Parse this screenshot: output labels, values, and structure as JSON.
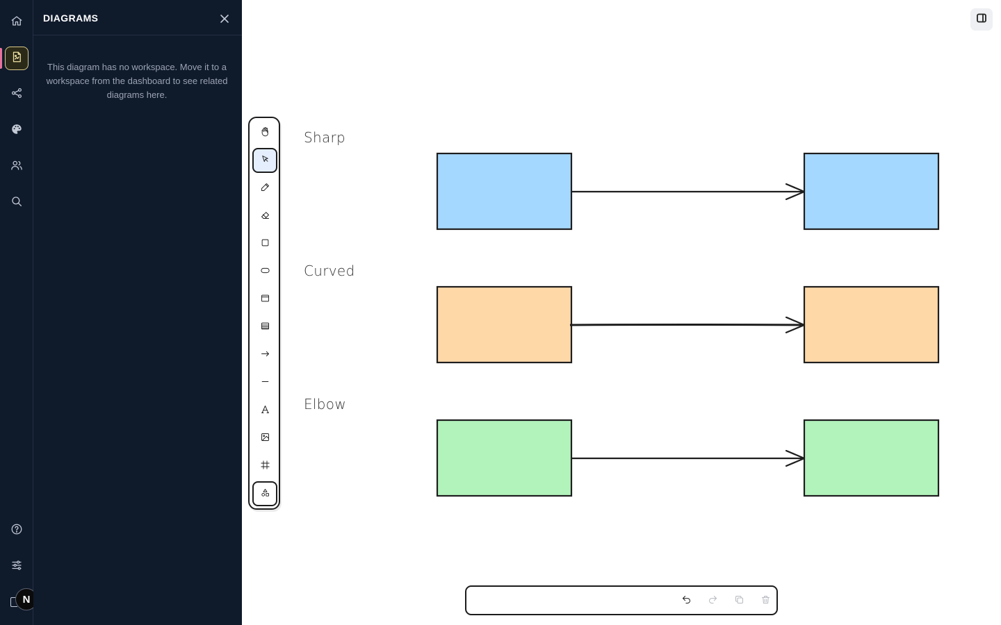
{
  "app": {
    "rail": {
      "items": [
        {
          "name": "home",
          "icon": "home-icon"
        },
        {
          "name": "diagrams",
          "icon": "diagram-file-icon",
          "active": true
        },
        {
          "name": "share",
          "icon": "share-icon"
        },
        {
          "name": "theme",
          "icon": "palette-icon"
        },
        {
          "name": "people",
          "icon": "users-icon"
        },
        {
          "name": "search",
          "icon": "search-icon"
        }
      ],
      "bottom_items": [
        {
          "name": "help",
          "icon": "help-circle-icon"
        },
        {
          "name": "settings",
          "icon": "sliders-icon"
        }
      ],
      "avatar_initial": "N"
    },
    "panel": {
      "title": "DIAGRAMS",
      "message": "This diagram has no workspace. Move it to a workspace from the dashboard to see related diagrams here."
    }
  },
  "toolbar": {
    "tools": [
      {
        "name": "hand",
        "icon": "hand-icon"
      },
      {
        "name": "select",
        "icon": "pointer-icon",
        "selected": true
      },
      {
        "name": "pencil",
        "icon": "pencil-icon"
      },
      {
        "name": "eraser",
        "icon": "eraser-icon"
      },
      {
        "name": "rectangle",
        "icon": "square-icon"
      },
      {
        "name": "ellipse",
        "icon": "ellipse-icon"
      },
      {
        "name": "card",
        "icon": "window-icon"
      },
      {
        "name": "table",
        "icon": "table-icon"
      },
      {
        "name": "arrow",
        "icon": "arrow-right-icon"
      },
      {
        "name": "line",
        "icon": "line-icon"
      },
      {
        "name": "text",
        "icon": "text-icon"
      },
      {
        "name": "image",
        "icon": "image-icon"
      },
      {
        "name": "frame",
        "icon": "frame-icon"
      },
      {
        "name": "shapes",
        "icon": "shapes-icon"
      }
    ]
  },
  "canvas": {
    "rows": [
      {
        "label": "Sharp",
        "fill": "#a5d8ff"
      },
      {
        "label": "Curved",
        "fill": "#ffd8a8"
      },
      {
        "label": "Elbow",
        "fill": "#b2f2bb"
      }
    ],
    "stroke_color": "#1e1e1e"
  },
  "bottom_bar": {
    "actions": [
      {
        "name": "undo",
        "icon": "undo-icon",
        "enabled": true
      },
      {
        "name": "redo",
        "icon": "redo-icon",
        "enabled": false
      },
      {
        "name": "duplicate",
        "icon": "copy-icon",
        "enabled": false
      },
      {
        "name": "delete",
        "icon": "trash-icon",
        "enabled": false
      }
    ]
  }
}
